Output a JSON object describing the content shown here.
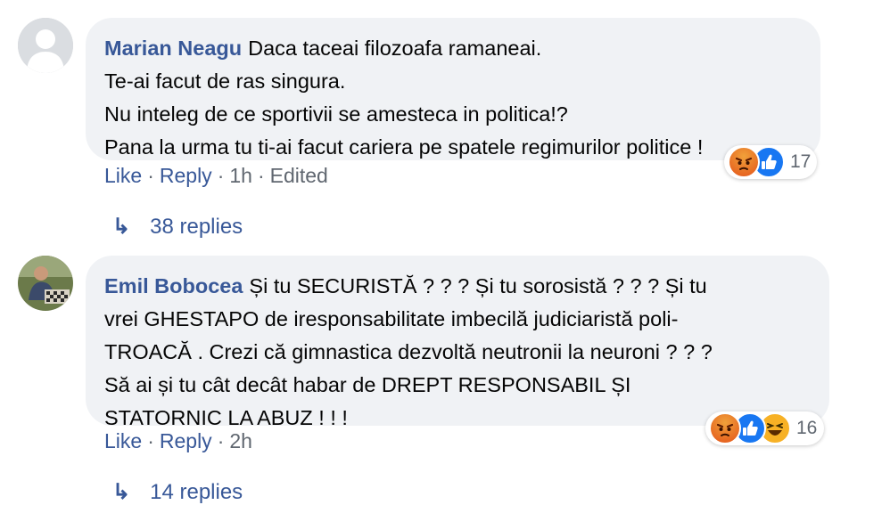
{
  "comments": [
    {
      "author": "Marian Neagu",
      "text_lines": [
        "Daca taceai filozoafa ramaneai.",
        "Te-ai facut de ras singura.",
        "Nu inteleg de ce sportivii se amesteca in politica!?",
        "Pana la urma tu ti-ai facut cariera pe spatele regimurilor politice !"
      ],
      "like_label": "Like",
      "reply_label": "Reply",
      "time": "1h",
      "edited_label": "Edited",
      "reaction_count": "17",
      "reaction_icons": [
        "angry-emoji",
        "like-thumb"
      ],
      "replies_label": "38 replies"
    },
    {
      "author": "Emil Bobocea",
      "text_lines": [
        "Și tu SECURISTĂ ? ? ? Și tu sorosistă ? ? ? Și tu",
        "vrei GHESTAPO de iresponsabilitate imbecilă judiciaristă poli-",
        "TROACĂ . Crezi că gimnastica dezvoltă neutronii la neuroni ? ? ?",
        "Să ai și tu cât decât habar de DREPT RESPONSABIL ȘI",
        "STATORNIC LA ABUZ ! ! !"
      ],
      "like_label": "Like",
      "reply_label": "Reply",
      "time": "2h",
      "reaction_count": "16",
      "reaction_icons": [
        "angry-emoji",
        "like-thumb",
        "haha-emoji"
      ],
      "replies_label": "14 replies"
    }
  ],
  "colors": {
    "link": "#385898",
    "bubble": "#f0f2f5",
    "meta": "#606770",
    "like_blue": "#1877f2",
    "angry_top": "#e9710f",
    "haha_yellow": "#f7b125"
  }
}
